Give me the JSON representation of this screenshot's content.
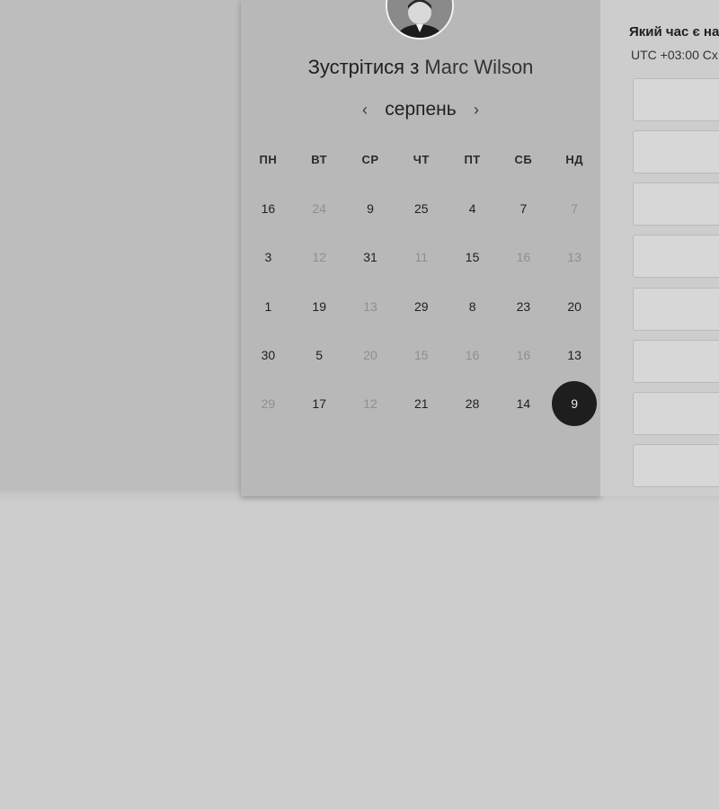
{
  "scheduler": {
    "title_prefix": "Зустрітися з",
    "host_name": "Marc Wilson",
    "month": "серпень",
    "prev_icon": "‹",
    "next_icon": "›",
    "weekdays": [
      "ПН",
      "ВТ",
      "СР",
      "ЧТ",
      "ПТ",
      "СБ",
      "НД"
    ],
    "weeks": [
      [
        {
          "d": "16",
          "muted": false
        },
        {
          "d": "24",
          "muted": true
        },
        {
          "d": "9",
          "muted": false
        },
        {
          "d": "25",
          "muted": false
        },
        {
          "d": "4",
          "muted": false
        },
        {
          "d": "7",
          "muted": false
        },
        {
          "d": "7",
          "muted": true
        }
      ],
      [
        {
          "d": "3",
          "muted": false
        },
        {
          "d": "12",
          "muted": true
        },
        {
          "d": "31",
          "muted": false
        },
        {
          "d": "11",
          "muted": true
        },
        {
          "d": "15",
          "muted": false
        },
        {
          "d": "16",
          "muted": true
        },
        {
          "d": "13",
          "muted": true
        }
      ],
      [
        {
          "d": "1",
          "muted": false
        },
        {
          "d": "19",
          "muted": false
        },
        {
          "d": "13",
          "muted": true
        },
        {
          "d": "29",
          "muted": false
        },
        {
          "d": "8",
          "muted": false
        },
        {
          "d": "23",
          "muted": false
        },
        {
          "d": "20",
          "muted": false
        }
      ],
      [
        {
          "d": "30",
          "muted": false
        },
        {
          "d": "5",
          "muted": false
        },
        {
          "d": "20",
          "muted": true
        },
        {
          "d": "15",
          "muted": true
        },
        {
          "d": "16",
          "muted": true
        },
        {
          "d": "16",
          "muted": true
        },
        {
          "d": "13",
          "muted": false
        }
      ],
      [
        {
          "d": "29",
          "muted": true
        },
        {
          "d": "17",
          "muted": false
        },
        {
          "d": "12",
          "muted": true
        },
        {
          "d": "21",
          "muted": false
        },
        {
          "d": "28",
          "muted": false
        },
        {
          "d": "14",
          "muted": false
        },
        {
          "d": "9",
          "muted": false,
          "selected": true
        }
      ]
    ]
  },
  "times": {
    "title": "Який час є на",
    "timezone": "UTC +03:00 Сх",
    "slot_count": 8
  },
  "colors": {
    "backdrop": "#bdbdbd",
    "panel": "#b8b8b8",
    "selected": "#1e1e1e"
  }
}
